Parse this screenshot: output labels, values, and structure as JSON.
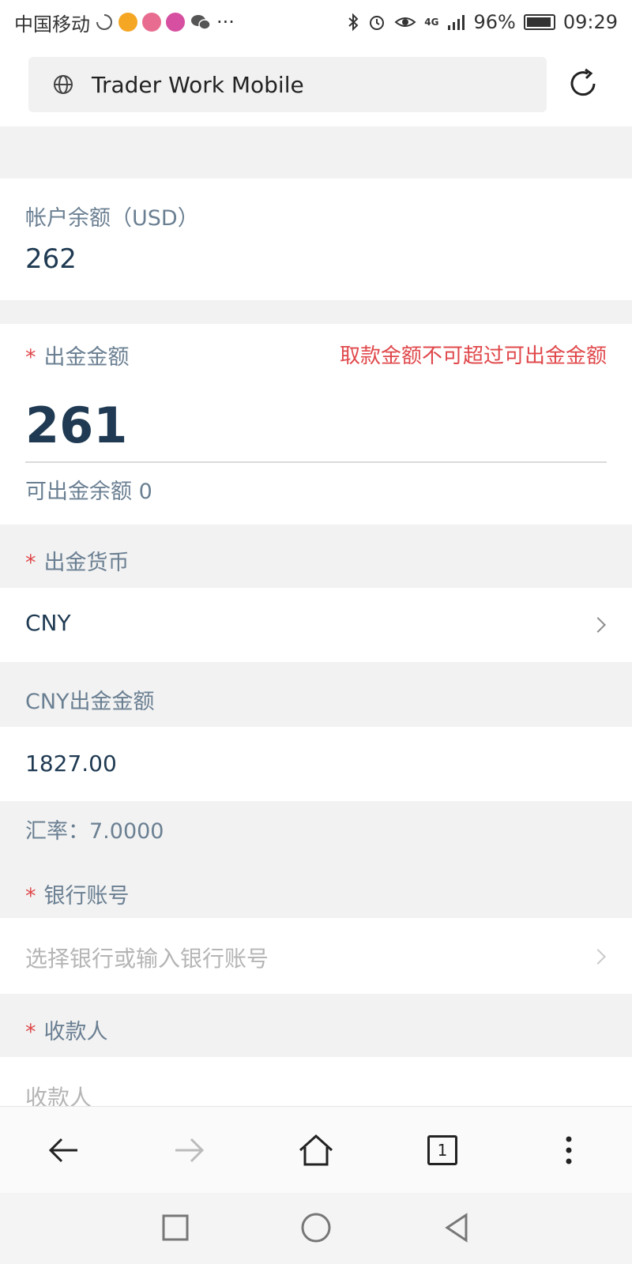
{
  "status_bar": {
    "carrier": "中国移动",
    "more": "···",
    "network": "4G",
    "battery": "96%",
    "time": "09:29"
  },
  "browser": {
    "url_title": "Trader Work Mobile"
  },
  "account": {
    "balance_label": "帐户余额（USD）",
    "balance_value": "262"
  },
  "withdraw": {
    "required_mark": "*",
    "amount_label": "出金金额",
    "error_message": "取款金额不可超过可出金金额",
    "amount_value": "261",
    "available_label": "可出金余额 0"
  },
  "currency": {
    "label": "出金货币",
    "value": "CNY"
  },
  "cny_amount": {
    "label": "CNY出金金额",
    "value": "1827.00"
  },
  "exchange_rate": {
    "text": "汇率：7.0000"
  },
  "bank": {
    "label": "银行账号",
    "placeholder": "选择银行或输入银行账号"
  },
  "payee": {
    "label": "收款人",
    "placeholder": "收款人"
  },
  "tabs": {
    "count": "1"
  },
  "colors": {
    "accent_red": "#e0484b",
    "value_text": "#1f3a52",
    "label_text": "#6a7f92"
  }
}
